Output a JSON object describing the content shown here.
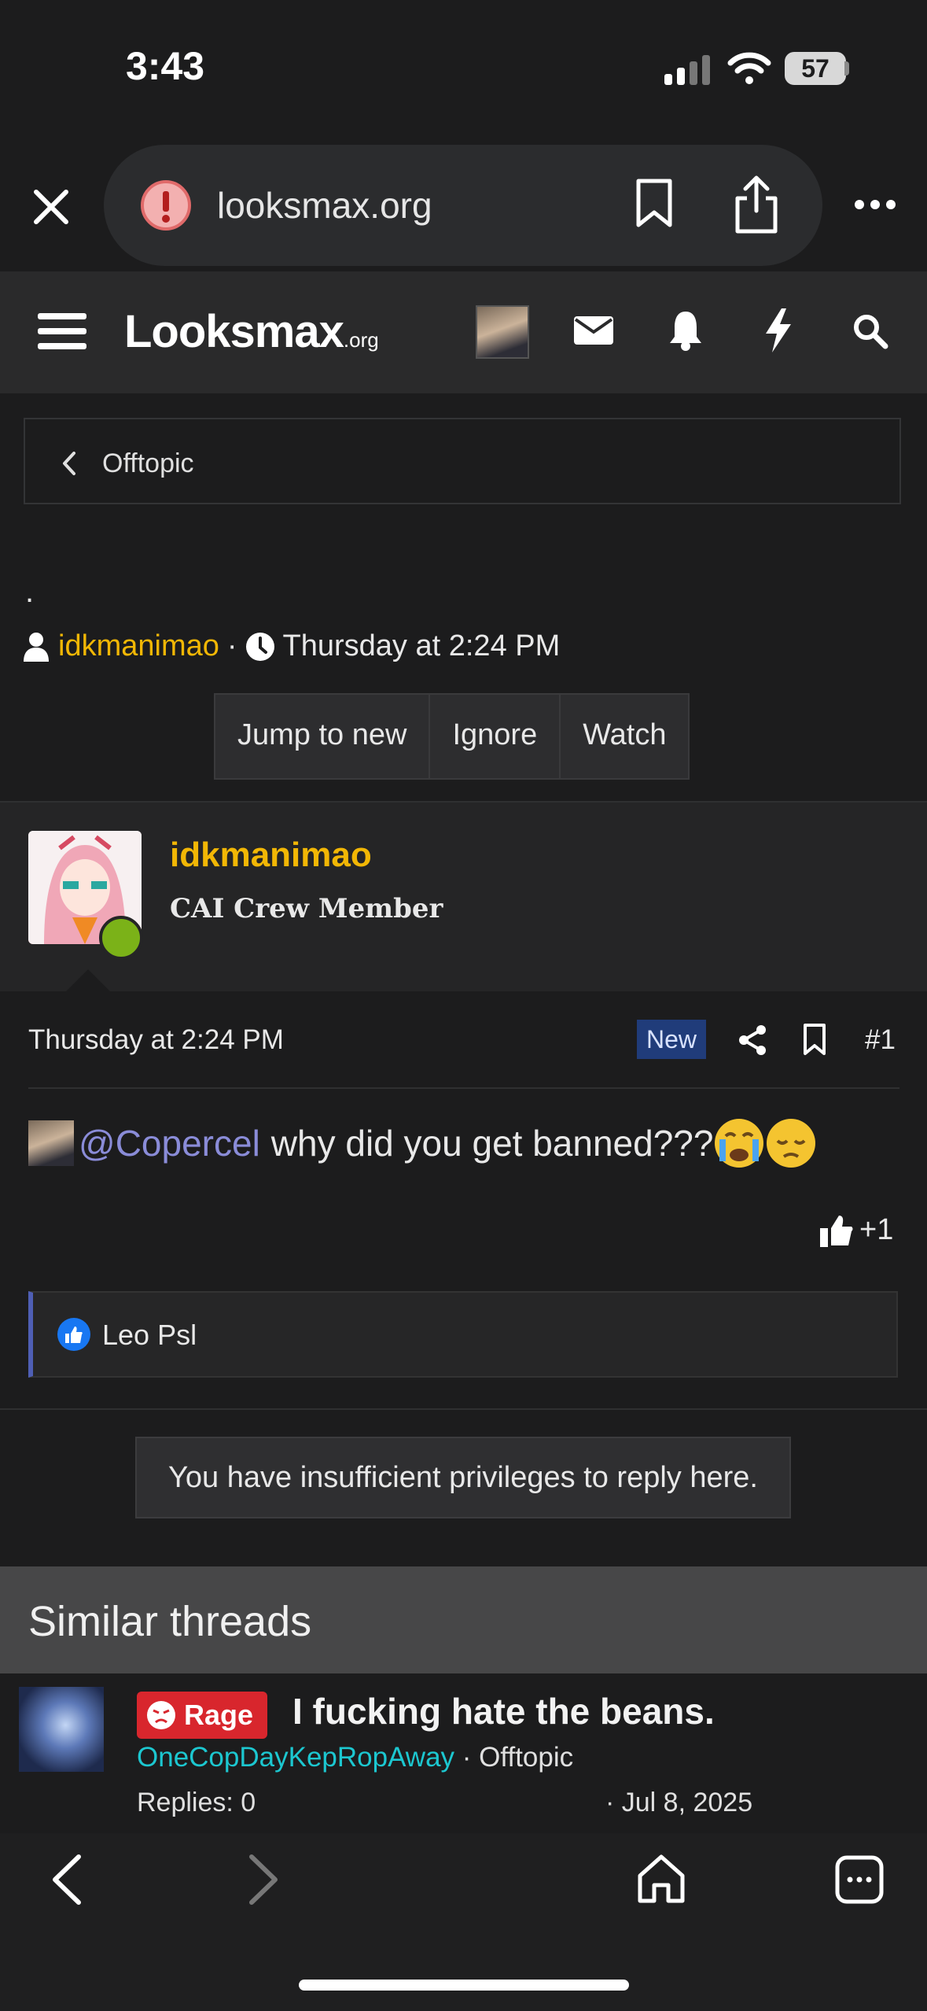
{
  "status_bar": {
    "time": "3:43",
    "battery": "57"
  },
  "browser": {
    "url": "looksmax.org"
  },
  "site": {
    "logo_main": "Looksmax",
    "logo_suffix": ".org"
  },
  "breadcrumb": {
    "label": "Offtopic"
  },
  "thread": {
    "title": ".",
    "author": "idkmanimao",
    "separator": "·",
    "timestamp": "Thursday at 2:24 PM",
    "actions": [
      "Jump to new",
      "Ignore",
      "Watch"
    ]
  },
  "post": {
    "username": "idkmanimao",
    "user_title": "CAI Crew Member",
    "date": "Thursday at 2:24 PM",
    "new_badge": "New",
    "number": "#1",
    "mention": "@Copercel",
    "body": "why did you get banned???",
    "reaction_score": "+1",
    "reactions_by": "Leo Psl"
  },
  "notice": "You have insufficient privileges to reply here.",
  "similar_threads": {
    "heading": "Similar threads",
    "items": [
      {
        "prefix": "Rage",
        "title": "I fucking hate the beans.",
        "author": "OneCopDayKepRopAway",
        "forum": "· Offtopic",
        "replies": "Replies: 0",
        "date": "· Jul 8, 2025"
      }
    ]
  },
  "colors": {
    "accent_user": "#f2b705",
    "mention": "#8a8cd8",
    "new_badge": "#203c7a",
    "rage": "#d8262d",
    "online": "#7bb218"
  }
}
